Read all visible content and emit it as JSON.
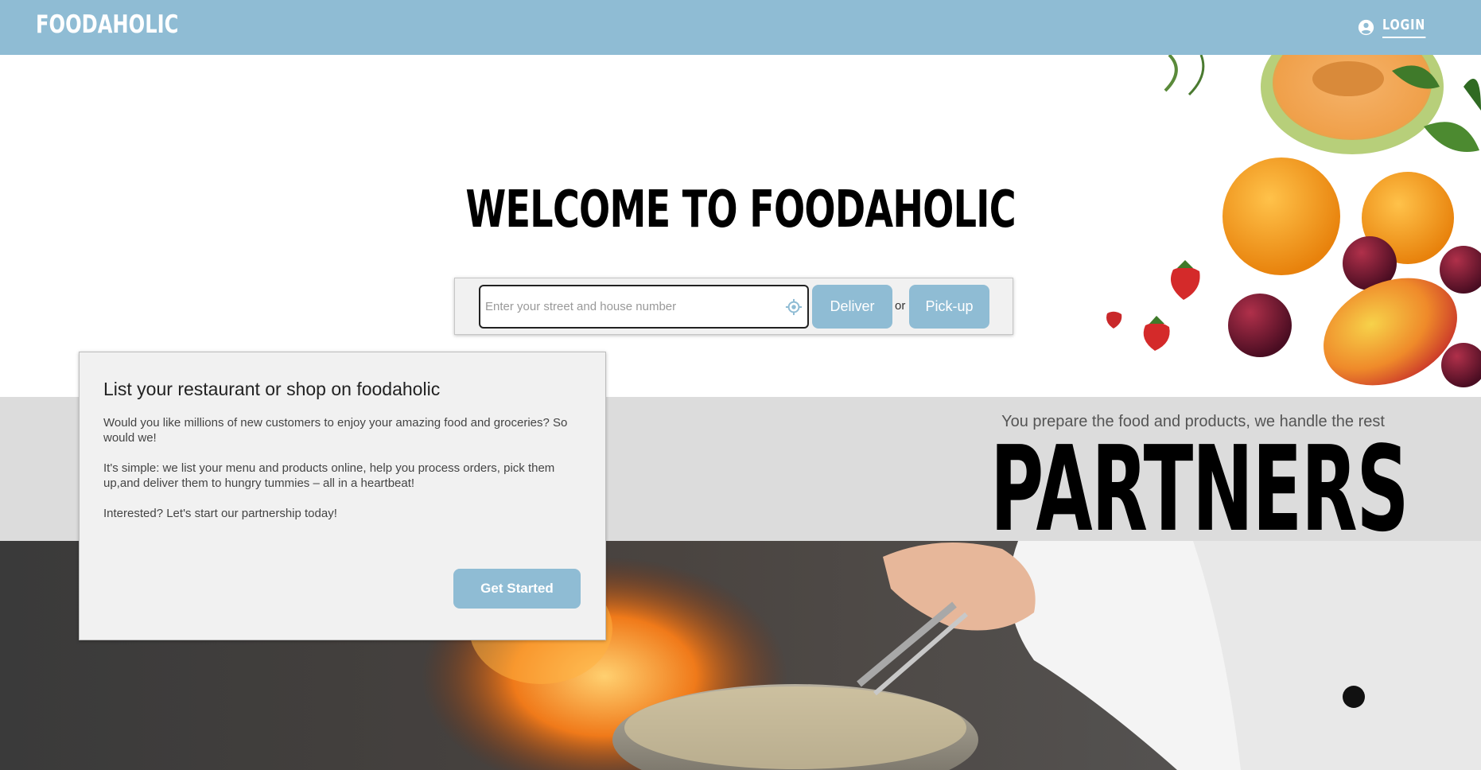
{
  "header": {
    "brand": "FOODAHOLIC",
    "login_label": "LOGIN"
  },
  "hero": {
    "title": "WELCOME TO FOODAHOLIC",
    "search": {
      "placeholder": "Enter your street and house number",
      "value": ""
    },
    "deliver_label": "Deliver",
    "or_label": "or",
    "pickup_label": "Pick-up"
  },
  "partners": {
    "subtitle": "You prepare the food and products, we handle the rest",
    "title": "PARTNERS"
  },
  "card": {
    "title": "List your restaurant or shop on foodaholic",
    "paragraph1": "Would you like millions of new customers to enjoy your amazing food and groceries? So would we!",
    "paragraph2": "It's simple: we list your menu and products online, help you process orders, pick them up,and deliver them to hungry tummies – all in a heartbeat!",
    "paragraph3": "Interested? Let's start our partnership today!",
    "cta_label": "Get Started"
  },
  "icons": {
    "login": "account-circle-icon",
    "locate": "crosshair-location-icon"
  },
  "colors": {
    "accent": "#8fbcd4",
    "band": "#dcdcdc",
    "card": "#f1f1f1"
  }
}
